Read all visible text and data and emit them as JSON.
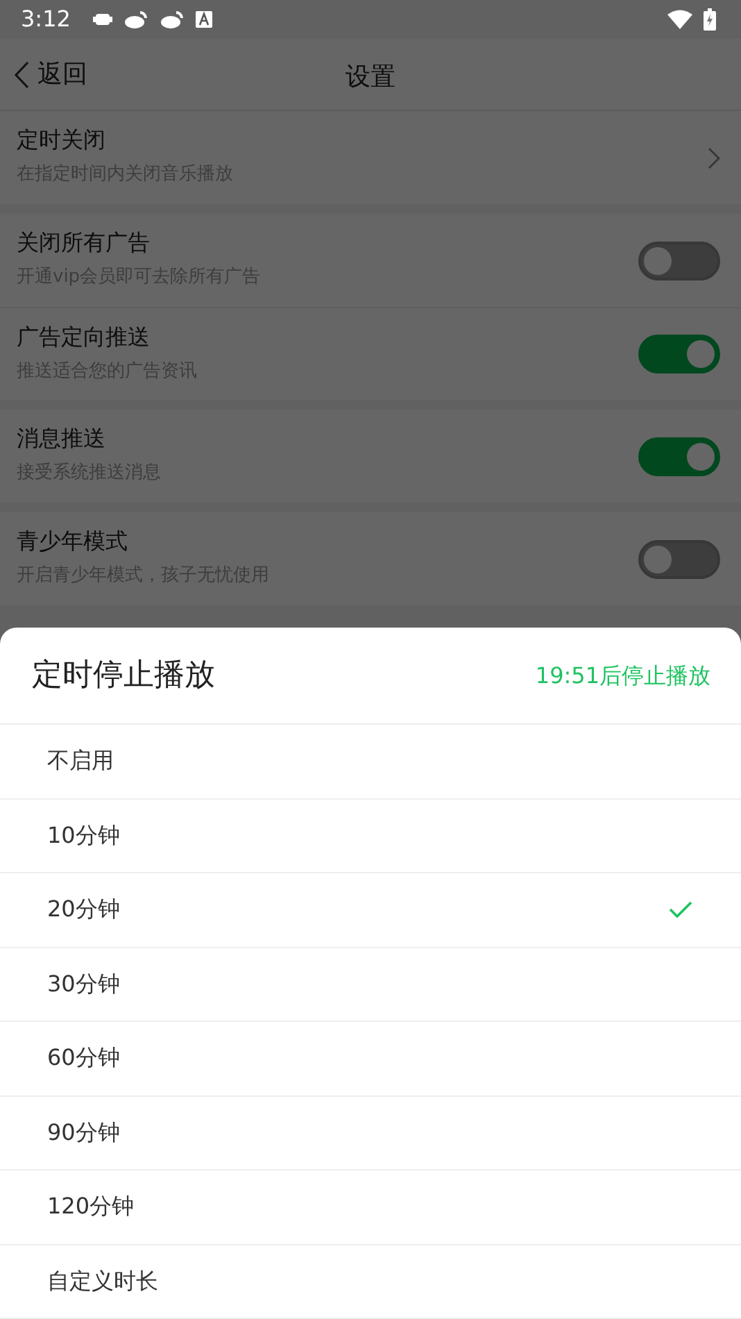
{
  "status_bar": {
    "time": "3:12"
  },
  "header": {
    "back": "返回",
    "title": "设置"
  },
  "groups": [
    [
      {
        "kind": "link",
        "title": "定时关闭",
        "subtitle": "在指定时间内关闭音乐播放"
      }
    ],
    [
      {
        "kind": "toggle",
        "title": "关闭所有广告",
        "subtitle": "开通vip会员即可去除所有广告",
        "on": false
      },
      {
        "kind": "toggle",
        "title": "广告定向推送",
        "subtitle": "推送适合您的广告资讯",
        "on": true
      }
    ],
    [
      {
        "kind": "toggle",
        "title": "消息推送",
        "subtitle": "接受系统推送消息",
        "on": true
      }
    ],
    [
      {
        "kind": "toggle",
        "title": "青少年模式",
        "subtitle": "开启青少年模式，孩子无忧使用",
        "on": false
      }
    ]
  ],
  "sheet": {
    "title": "定时停止播放",
    "status": "19:51后停止播放",
    "options": [
      {
        "label": "不启用",
        "selected": false
      },
      {
        "label": "10分钟",
        "selected": false
      },
      {
        "label": "20分钟",
        "selected": true
      },
      {
        "label": "30分钟",
        "selected": false
      },
      {
        "label": "60分钟",
        "selected": false
      },
      {
        "label": "90分钟",
        "selected": false
      },
      {
        "label": "120分钟",
        "selected": false
      },
      {
        "label": "自定义时长",
        "selected": false
      }
    ]
  }
}
